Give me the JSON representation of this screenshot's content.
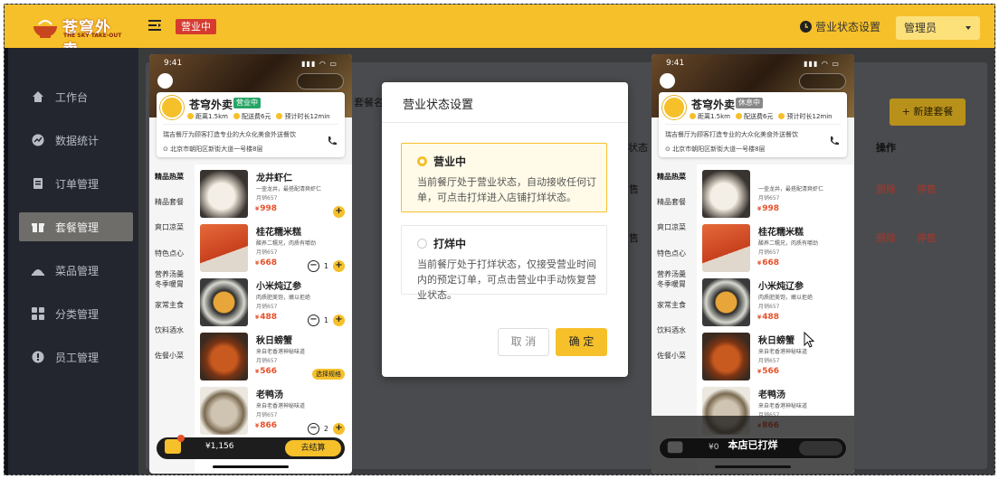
{
  "brand": {
    "name": "苍穹外卖",
    "sub": "THE SKY TAKE-OUT"
  },
  "header": {
    "status_badge": "营业中",
    "settings_link": "营业状态设置",
    "admin_label": "管理员"
  },
  "sidebar": {
    "items": [
      {
        "label": "工作台",
        "icon": "home-icon"
      },
      {
        "label": "数据统计",
        "icon": "chart-icon"
      },
      {
        "label": "订单管理",
        "icon": "order-icon"
      },
      {
        "label": "套餐管理",
        "icon": "gift-icon",
        "active": true
      },
      {
        "label": "菜品管理",
        "icon": "dish-icon"
      },
      {
        "label": "分类管理",
        "icon": "grid-icon"
      },
      {
        "label": "员工管理",
        "icon": "user-icon"
      }
    ]
  },
  "bg_page": {
    "header_frag": "套餐名",
    "status_col": "状态",
    "ops_col": "操作",
    "new_button": "+ 新建套餐",
    "row1_status": "售",
    "row2_status": "售",
    "delete": "删除",
    "disable": "停售"
  },
  "phone_left": {
    "time": "9:41",
    "shop_name": "苍穹外卖",
    "shop_tag": "营业中",
    "meta": [
      "距离1.5km",
      "配送费6元",
      "预计时长12min"
    ],
    "desc": "瑞吉餐厅为顾客打造专业的大众化美食外送餐饮",
    "address": "北京市朝阳区新街大道一号楼8层",
    "cart_amount": "¥1,156",
    "checkout": "去结算"
  },
  "phone_right": {
    "time": "9:41",
    "shop_name": "苍穹外卖",
    "shop_tag": "休息中",
    "meta": [
      "距离1.5km",
      "配送费6元",
      "预计时长12min"
    ],
    "desc": "瑞吉餐厅为顾客打造专业的大众化美食外送餐饮",
    "address": "北京市朝阳区新街大道一号楼8层",
    "cart_amount": "¥0",
    "closed_label": "本店已打烊"
  },
  "categories": [
    "精品热菜",
    "精品套餐",
    "爽口凉菜",
    "特色点心",
    "营养汤羹\n冬季暖胃",
    "家常主食",
    "饮料酒水",
    "佐餐小菜"
  ],
  "dishes": [
    {
      "name": "龙井虾仁",
      "desc": "一壶龙井，最搭配清爽虾仁",
      "sales": "月销657",
      "price": "998"
    },
    {
      "name": "桂花糯米糕",
      "desc": "酸养二糯兄，肉质有嚼劲",
      "sales": "月销657",
      "price": "668"
    },
    {
      "name": "小米炖辽参",
      "desc": "肉质肥美饱，嫩以拒绝",
      "sales": "月销657",
      "price": "488"
    },
    {
      "name": "秋日螃蟹",
      "desc": "来自老香港神秘味道",
      "sales": "月销657",
      "price": "566"
    },
    {
      "name": "老鸭汤",
      "desc": "来自老香港神秘味道",
      "sales": "月销657",
      "price": "866"
    }
  ],
  "right_dish0_desc": "一壶龙井，最搭配清爽虾仁",
  "qty": {
    "item2": "1",
    "item3": "1",
    "item5": "2",
    "spec": "选择规格"
  },
  "modal": {
    "title": "营业状态设置",
    "options": [
      {
        "label": "营业中",
        "desc": "当前餐厅处于营业状态，自动接收任何订单，可点击打烊进入店铺打烊状态。"
      },
      {
        "label": "打烊中",
        "desc": "当前餐厅处于打烊状态，仅接受营业时间内的预定订单，可点击营业中手动恢复营业状态。"
      }
    ],
    "cancel": "取 消",
    "confirm": "确 定"
  },
  "colors": {
    "brand": "#f6c02b",
    "sidebar": "#23262e",
    "badge": "#d63b2f",
    "price": "#e8502a"
  }
}
